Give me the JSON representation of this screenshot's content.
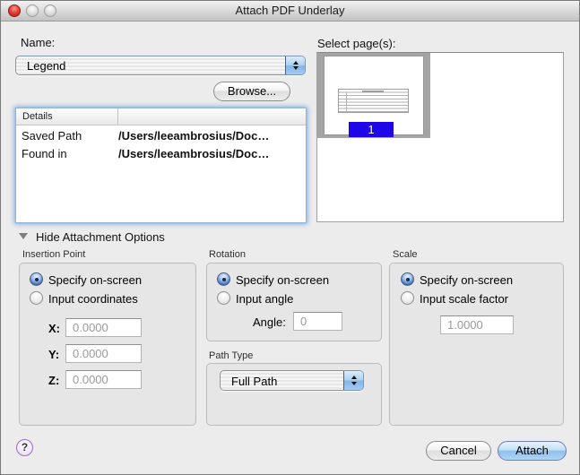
{
  "window": {
    "title": "Attach PDF Underlay"
  },
  "name_section": {
    "label": "Name:",
    "value": "Legend",
    "browse_label": "Browse..."
  },
  "details_table": {
    "header": "Details",
    "rows": [
      {
        "label": "Saved Path",
        "value": "/Users/leeambrosius/Doc…"
      },
      {
        "label": "Found in",
        "value": "/Users/leeambrosius/Doc…"
      }
    ]
  },
  "pages_section": {
    "label": "Select page(s):",
    "page_number": "1"
  },
  "options_toggle": {
    "label": "Hide Attachment Options"
  },
  "insertion_point": {
    "label": "Insertion Point",
    "radio_specify": "Specify on-screen",
    "radio_input": "Input coordinates",
    "fields": [
      {
        "label": "X:",
        "value": "0.0000"
      },
      {
        "label": "Y:",
        "value": "0.0000"
      },
      {
        "label": "Z:",
        "value": "0.0000"
      }
    ]
  },
  "rotation": {
    "label": "Rotation",
    "radio_specify": "Specify on-screen",
    "radio_input": "Input angle",
    "angle_label": "Angle:",
    "angle_value": "0"
  },
  "path_type": {
    "label": "Path Type",
    "value": "Full Path"
  },
  "scale": {
    "label": "Scale",
    "radio_specify": "Specify on-screen",
    "radio_input": "Input scale factor",
    "value": "1.0000"
  },
  "footer": {
    "help_label": "?",
    "cancel_label": "Cancel",
    "attach_label": "Attach"
  },
  "colors": {
    "accent_blue": "#3d6cb4",
    "page_badge_blue": "#1e06e8",
    "focus_ring_blue": "#6ea0e1",
    "selection_gray": "#a4a4a4"
  }
}
